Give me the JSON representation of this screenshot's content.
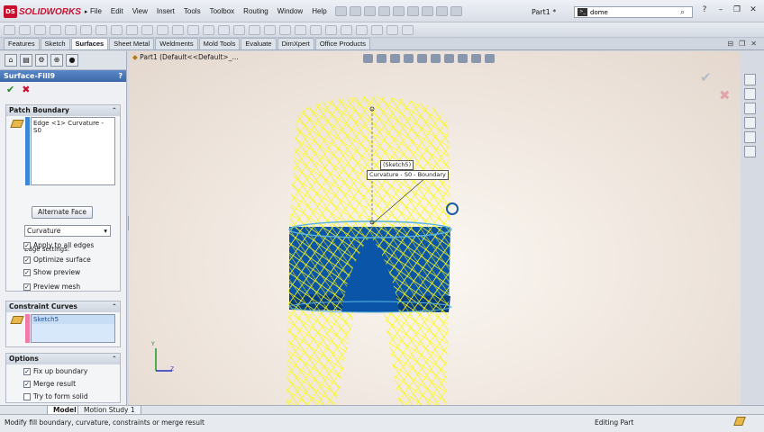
{
  "app": {
    "brand": "SOLIDWORKS",
    "logo_text": "DS",
    "document_title": "Part1 *"
  },
  "menu": [
    "File",
    "Edit",
    "View",
    "Insert",
    "Tools",
    "Toolbox",
    "Routing",
    "Window",
    "Help"
  ],
  "search": {
    "value": "dome"
  },
  "tabs": [
    {
      "label": "Features",
      "active": false
    },
    {
      "label": "Sketch",
      "active": false
    },
    {
      "label": "Surfaces",
      "active": true
    },
    {
      "label": "Sheet Metal",
      "active": false
    },
    {
      "label": "Weldments",
      "active": false
    },
    {
      "label": "Mold Tools",
      "active": false
    },
    {
      "label": "Evaluate",
      "active": false
    },
    {
      "label": "DimXpert",
      "active": false
    },
    {
      "label": "Office Products",
      "active": false
    }
  ],
  "property_manager": {
    "feature_name": "Surface-Fill9",
    "help": "?",
    "patch_boundary": {
      "title": "Patch Boundary",
      "edges": [
        "Edge <1> Curvature - S0"
      ],
      "edge_settings_label": "Edge settings:",
      "alternate_face_label": "Alternate Face",
      "curvature_select": "Curvature",
      "apply_all_edges": "Apply to all edges",
      "optimize_surface": "Optimize surface",
      "show_preview": "Show preview",
      "preview_mesh": "Preview mesh"
    },
    "constraint_curves": {
      "title": "Constraint Curves",
      "items": [
        "Sketch5"
      ]
    },
    "options": {
      "title": "Options",
      "fix_up_boundary": "Fix up boundary",
      "merge_result": "Merge result",
      "try_to_form_solid": "Try to form solid"
    }
  },
  "viewport": {
    "tree_label": "Part1  (Default<<Default>_...",
    "callout_sketch": "(Sketch5)",
    "callout_boundary": "Curvature - S0 - Boundary",
    "triad_y": "Y",
    "triad_z": "Z"
  },
  "model_tabs": [
    "Model",
    "Motion Study 1"
  ],
  "status": {
    "message": "Modify fill boundary, curvature, constraints or merge result",
    "mode": "Editing Part"
  },
  "colors": {
    "preview_yellow": "#ffff1a",
    "body_blue": "#0b55a8",
    "boundary_cyan": "#5ab4e0",
    "accent_red": "#c8102e"
  }
}
